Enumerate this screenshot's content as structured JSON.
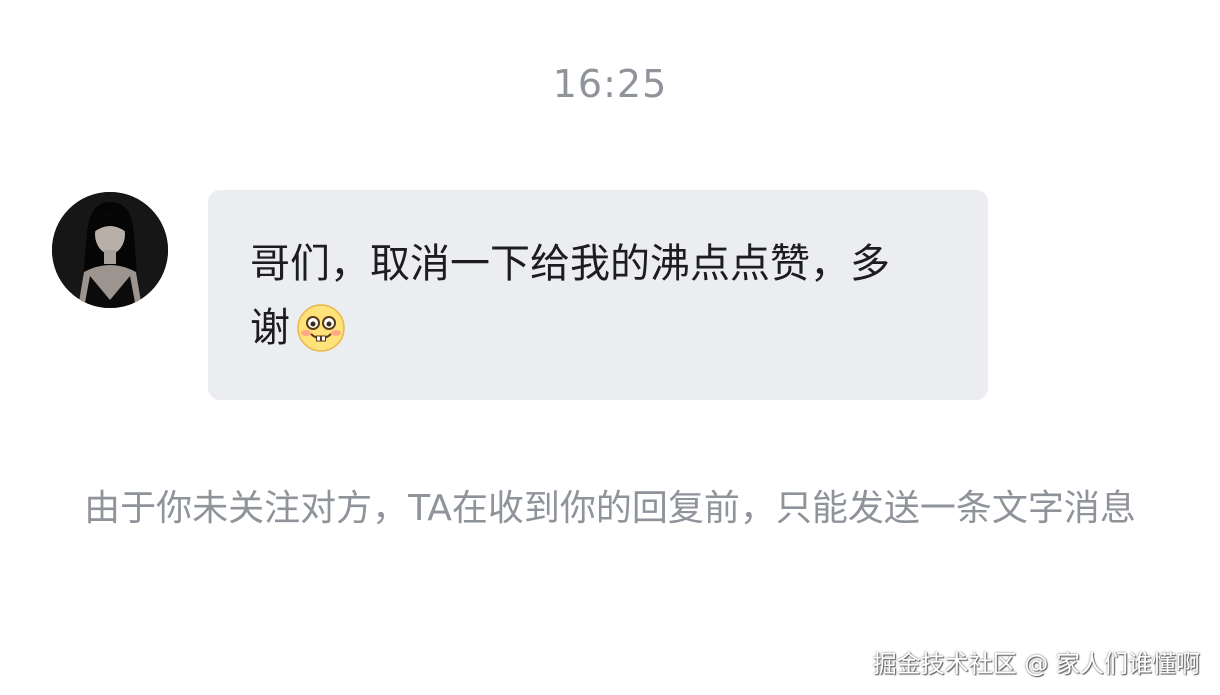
{
  "chat": {
    "timestamp": "16:25",
    "message": {
      "text": "哥们，取消一下给我的沸点点赞，多谢",
      "emoji": "grinning-face-emoji"
    },
    "notice": "由于你未关注对方，TA在收到你的回复前，只能发送一条文字消息"
  },
  "watermark": "掘金技术社区 @ 家人们谁懂啊",
  "colors": {
    "background": "#ffffff",
    "bubble": "#ebedf0",
    "text": "#1d1d1f",
    "muted": "#8f939a"
  }
}
